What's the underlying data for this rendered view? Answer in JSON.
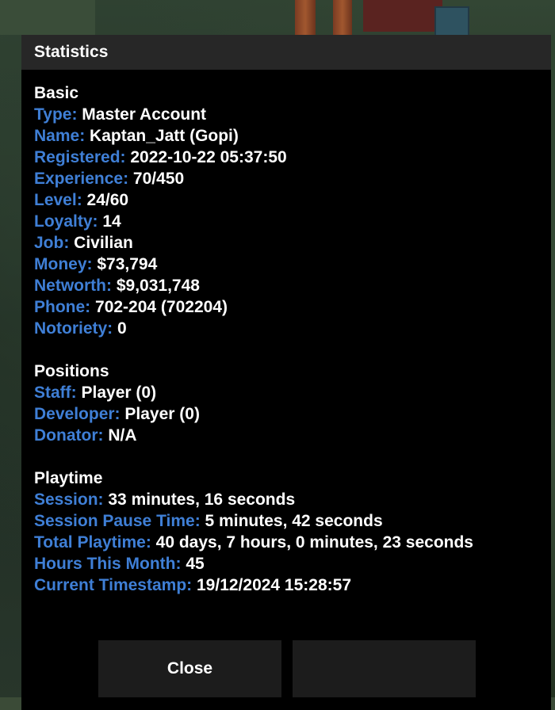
{
  "dialog": {
    "title": "Statistics",
    "close_label": "Close",
    "secondary_label": ""
  },
  "basic": {
    "heading": "Basic",
    "rows": [
      {
        "label": "Type:",
        "value": "Master Account"
      },
      {
        "label": "Name:",
        "value": "Kaptan_Jatt (Gopi)"
      },
      {
        "label": "Registered:",
        "value": "2022-10-22 05:37:50"
      },
      {
        "label": "Experience:",
        "value": "70/450"
      },
      {
        "label": "Level:",
        "value": "24/60"
      },
      {
        "label": "Loyalty:",
        "value": "14"
      },
      {
        "label": "Job:",
        "value": "Civilian"
      },
      {
        "label": "Money:",
        "value": "$73,794"
      },
      {
        "label": "Networth:",
        "value": "$9,031,748"
      },
      {
        "label": "Phone:",
        "value": "702-204 (702204)"
      },
      {
        "label": "Notoriety:",
        "value": "0"
      }
    ]
  },
  "positions": {
    "heading": "Positions",
    "rows": [
      {
        "label": "Staff:",
        "value": "Player (0)"
      },
      {
        "label": "Developer:",
        "value": "Player (0)"
      },
      {
        "label": "Donator:",
        "value": "N/A"
      }
    ]
  },
  "playtime": {
    "heading": "Playtime",
    "rows": [
      {
        "label": "Session:",
        "value": "33 minutes, 16 seconds"
      },
      {
        "label": "Session Pause Time:",
        "value": "5 minutes, 42 seconds"
      },
      {
        "label": "Total Playtime:",
        "value": "40 days, 7 hours, 0 minutes, 23 seconds"
      },
      {
        "label": "Hours This Month:",
        "value": "45"
      },
      {
        "label": "Current Timestamp:",
        "value": "19/12/2024 15:28:57"
      }
    ]
  },
  "colors": {
    "label": "#3f7fd6",
    "value": "#ffffff",
    "titlebar": "#272727",
    "panel": "#000000",
    "button": "#1c1c1c"
  }
}
